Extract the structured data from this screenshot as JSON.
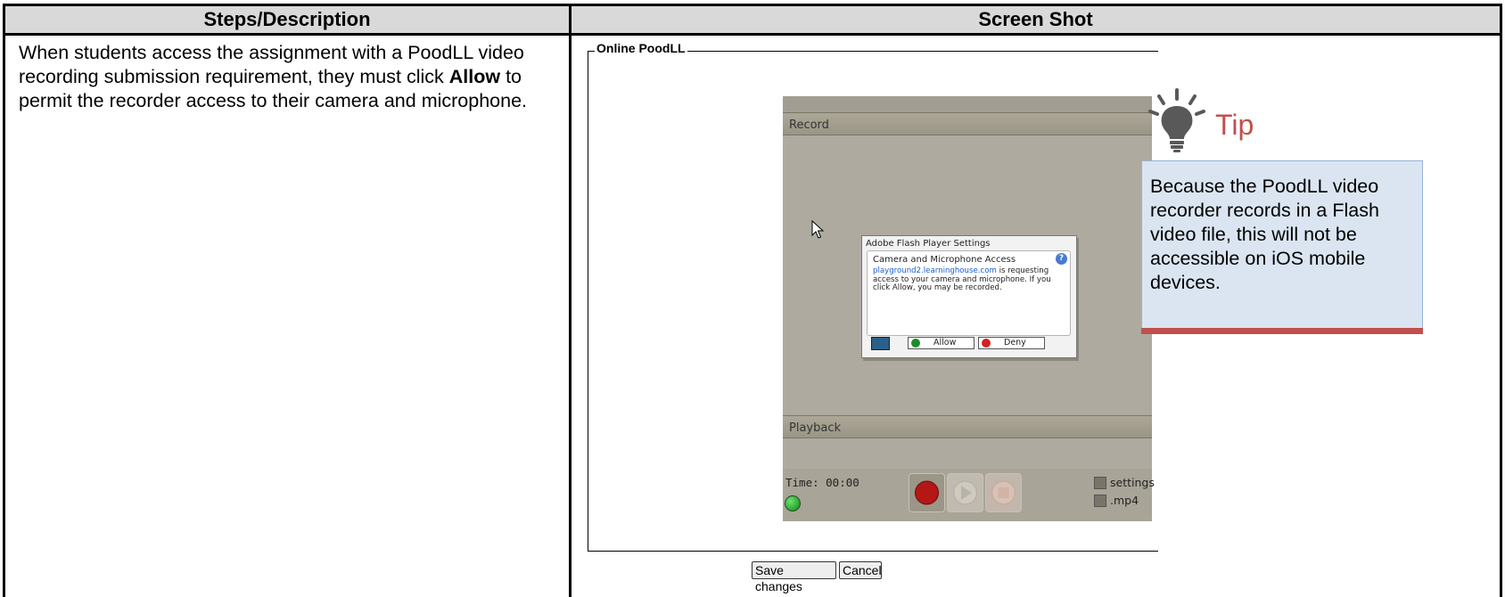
{
  "table": {
    "headers": [
      "Steps/Description",
      "Screen Shot"
    ],
    "step_text_before": "When students access the assignment with a PoodLL video recording submission requirement, they must click ",
    "step_text_bold": "Allow",
    "step_text_after": " to permit the recorder access to their camera and microphone."
  },
  "screenshot": {
    "fieldset_legend": "Online PoodLL",
    "record_label": "Record",
    "playback_label": "Playback",
    "time_text": "Time: 00:00",
    "settings_label": "settings",
    "mp4_label": ".mp4",
    "dialog": {
      "title": "Adobe Flash Player Settings",
      "heading": "Camera and Microphone Access",
      "help_glyph": "?",
      "domain": "playground2.learninghouse.com",
      "message": " is requesting access to your camera and microphone. If you click Allow, you may be recorded.",
      "allow_label": "Allow",
      "deny_label": "Deny"
    },
    "save_label": "Save changes",
    "cancel_label": "Cancel"
  },
  "tip": {
    "title": "Tip",
    "text": "Because the PoodLL video recorder records in a Flash video file, this will not be accessible on iOS mobile devices.",
    "colors": {
      "title": "#c0504d",
      "box": "#dbe5f1",
      "accent": "#c0504d"
    },
    "icon": "lightbulb-icon"
  }
}
